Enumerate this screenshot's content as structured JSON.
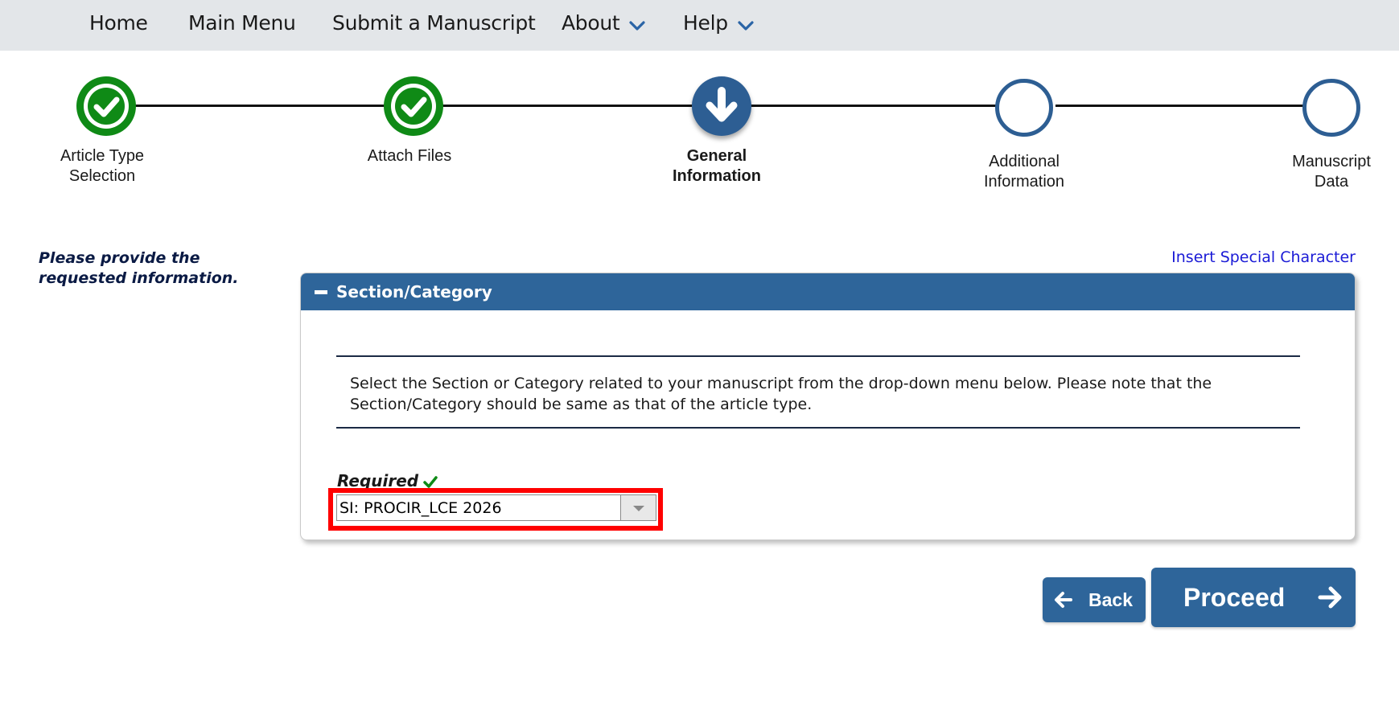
{
  "nav": {
    "items": [
      {
        "label": "Home"
      },
      {
        "label": "Main Menu"
      },
      {
        "label": "Submit a Manuscript"
      },
      {
        "label": "About"
      },
      {
        "label": "Help"
      }
    ]
  },
  "steps": [
    {
      "label_line1": "Article Type",
      "label_line2": "Selection",
      "state": "done"
    },
    {
      "label_line1": "Attach Files",
      "label_line2": "",
      "state": "done"
    },
    {
      "label_line1": "General",
      "label_line2": "Information",
      "state": "current"
    },
    {
      "label_line1": "Additional",
      "label_line2": "Information",
      "state": "todo"
    },
    {
      "label_line1": "Manuscript",
      "label_line2": "Data",
      "state": "todo"
    }
  ],
  "instruction": {
    "line1": "Please provide the",
    "line2": "requested information."
  },
  "special_char_link": "Insert Special Character",
  "panel": {
    "title": "Section/Category",
    "description_line1": "Select the Section or Category related to your manuscript from the drop-down menu below. Please note that the",
    "description_line2": "Section/Category should be same as that of the article type.",
    "required_label": "Required",
    "select_value": "SI: PROCIR_LCE 2026"
  },
  "buttons": {
    "back": "Back",
    "proceed": "Proceed"
  },
  "colors": {
    "accent": "#2e659a",
    "done": "#0f8a16",
    "highlight": "#ff0000",
    "link": "#1a1ad6"
  }
}
